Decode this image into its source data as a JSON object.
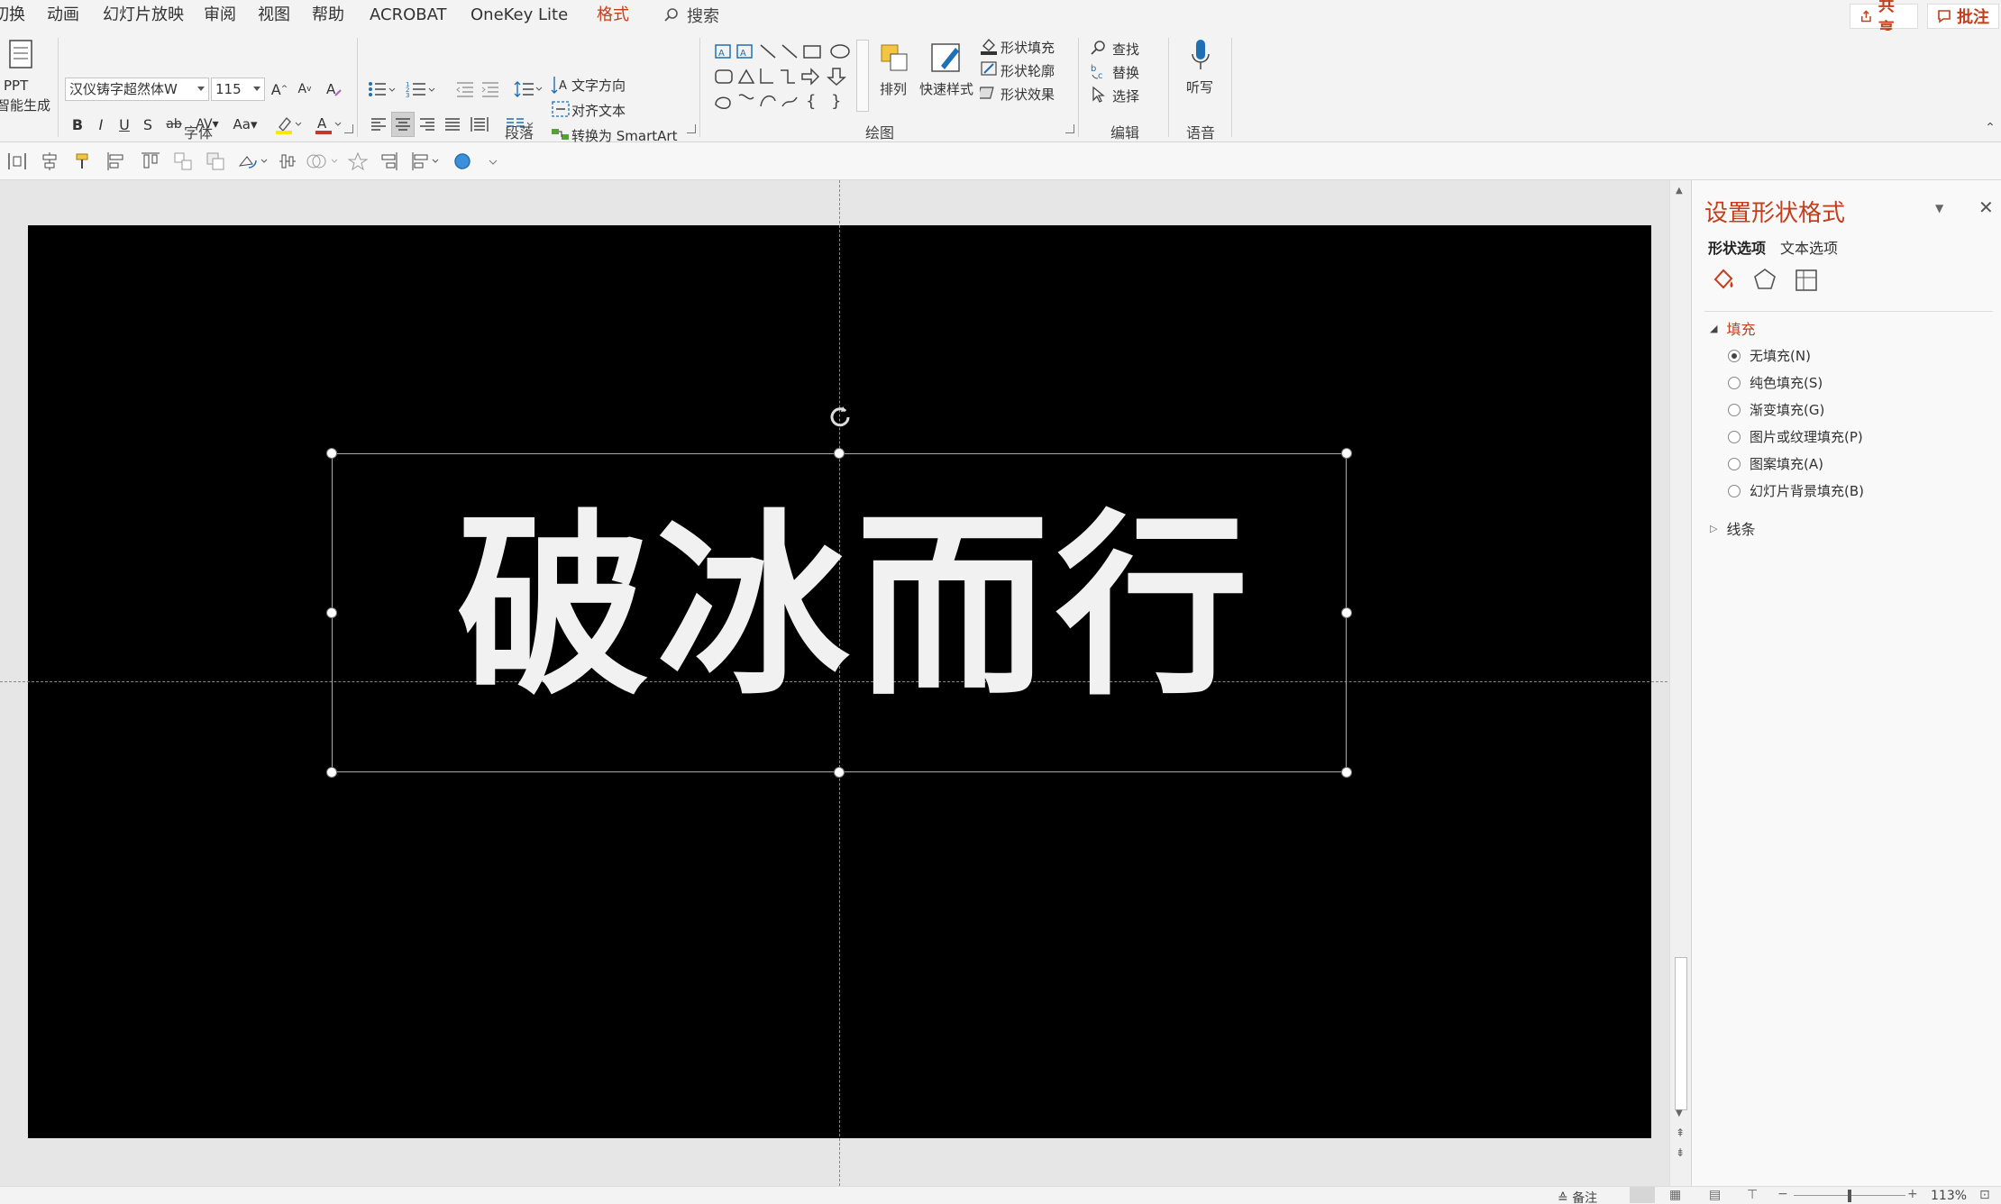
{
  "tabs": [
    "切换",
    "动画",
    "幻灯片放映",
    "审阅",
    "视图",
    "帮助",
    "ACROBAT",
    "OneKey Lite",
    "格式"
  ],
  "active_tab": "格式",
  "search_label": "搜索",
  "share_label": "共享",
  "comment_label": "批注",
  "ribbon": {
    "ppt_button": {
      "line1": "PPT",
      "line2": "智能生成"
    },
    "font": {
      "name": "汉仪铸字超然体W",
      "size": "115",
      "group_label": "字体"
    },
    "paragraph": {
      "text_direction": "文字方向",
      "align_text": "对齐文本",
      "smartart": "转换为 SmartArt",
      "group_label": "段落"
    },
    "drawing": {
      "arrange": "排列",
      "quick_styles": "快速样式",
      "shape_fill": "形状填充",
      "shape_outline": "形状轮廓",
      "shape_effects": "形状效果",
      "group_label": "绘图"
    },
    "editing": {
      "find": "查找",
      "replace": "替换",
      "select": "选择",
      "group_label": "编辑"
    },
    "voice": {
      "dictate": "听写",
      "group_label": "语音"
    }
  },
  "slide": {
    "text": "破冰而行",
    "background": "#000000"
  },
  "format_pane": {
    "title": "设置形状格式",
    "tabs": [
      "形状选项",
      "文本选项"
    ],
    "fill_section": "填充",
    "fill_options": [
      {
        "label": "无填充(N)",
        "selected": true
      },
      {
        "label": "纯色填充(S)",
        "selected": false
      },
      {
        "label": "渐变填充(G)",
        "selected": false
      },
      {
        "label": "图片或纹理填充(P)",
        "selected": false
      },
      {
        "label": "图案填充(A)",
        "selected": false
      },
      {
        "label": "幻灯片背景填充(B)",
        "selected": false
      }
    ],
    "line_section": "线条"
  },
  "status": {
    "notes": "备注",
    "zoom": "113%"
  },
  "colors": {
    "accent": "#c43e1c",
    "ribbon_bg": "#f3f3f3"
  }
}
